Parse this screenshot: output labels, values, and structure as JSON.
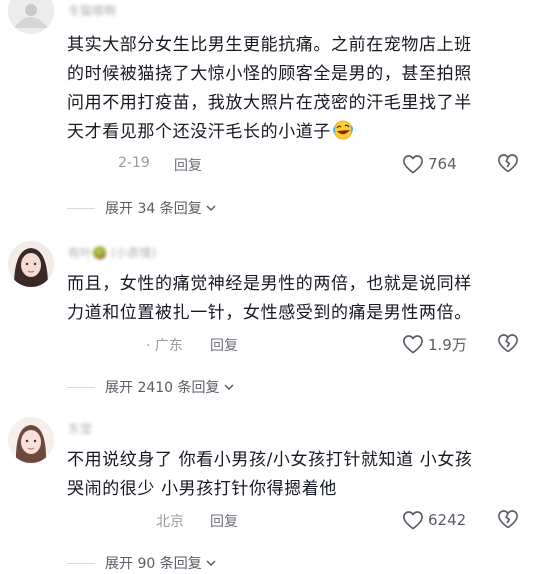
{
  "comments": [
    {
      "username": "冬猫哪啊",
      "text_lines": [
        "其实大部分女生比男生更能抗痛。之前在宠物店上班",
        "的时候被猫挠了大惊小怪的顾客全是男的，甚至拍照",
        "问用不用打疫苗，我放大照片在茂密的汗毛里找了半",
        "天才看见那个还没汗毛长的小道子"
      ],
      "emoji": "rolling-laughing-emoji",
      "date": "2-19",
      "reply_label": "回复",
      "likes": "764",
      "expand_label": "展开 34 条回复"
    },
    {
      "username": "有叶🥝 (小表情)",
      "text_lines": [
        "而且，女性的痛觉神经是男性的两倍，也就是说同样",
        "力道和位置被扎一针，女性感受到的痛是男性两倍。"
      ],
      "location": "· 广东",
      "reply_label": "回复",
      "likes": "1.9万",
      "expand_label": "展开 2410 条回复"
    },
    {
      "username": "东莹",
      "text_lines": [
        "不用说纹身了 你看小男孩/小女孩打针就知道 小女孩",
        "哭闹的很少 小男孩打针你得摁着他"
      ],
      "location": "北京",
      "reply_label": "回复",
      "likes": "6242",
      "expand_label": "展开 90 条回复"
    }
  ],
  "colors": {
    "text": "#161823",
    "meta": "#9a9ba0",
    "reply": "#6e7079",
    "divider": "#d8d9dc"
  }
}
